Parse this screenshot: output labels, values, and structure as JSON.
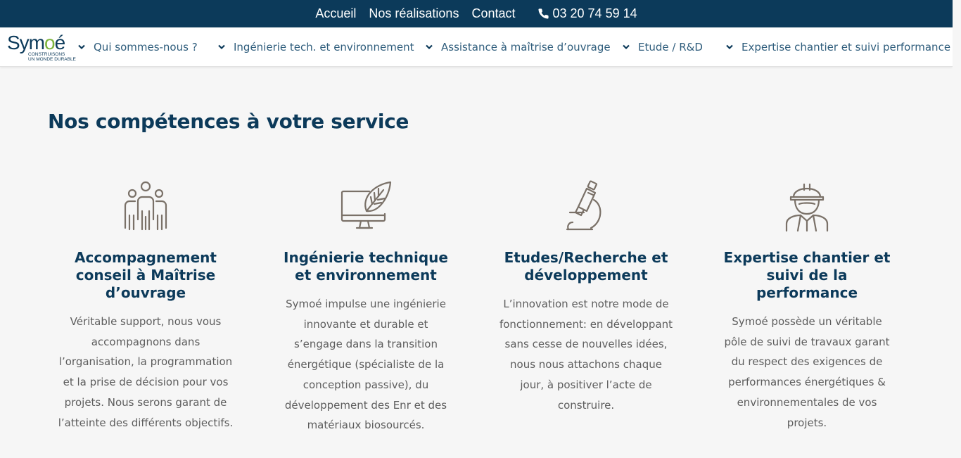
{
  "topbar": {
    "links": [
      "Accueil",
      "Nos réalisations",
      "Contact"
    ],
    "phone": "03 20 74 59 14",
    "bg_color": "#0c3a5a"
  },
  "logo": {
    "word_left": "Sym",
    "word_mid": "o",
    "word_right": "é",
    "tagline_1": "CONSTRUISONS",
    "tagline_2": "UN MONDE DURABLE"
  },
  "nav": {
    "items": [
      "Qui sommes-nous ?",
      "Ingénierie tech. et environnement",
      "Assistance à maîtrise d’ouvrage",
      "Etude / R&D",
      "Expertise chantier et suivi performance"
    ]
  },
  "main": {
    "title": "Nos compétences à votre service",
    "services": [
      {
        "icon": "team-icon",
        "title": "Accompagnement conseil à Maîtrise d’ouvrage",
        "text": "Véritable support, nous vous accompagnons dans l’organisation, la programmation et la prise de décision pour vos projets. Nous serons garant de l’atteinte des différents objectifs."
      },
      {
        "icon": "monitor-leaf-icon",
        "title": "Ingénierie technique et environnement",
        "text": "Symoé impulse une ingénierie innovante et durable et s’engage dans la transition énergétique (spécialiste de la conception passive), du développement des Enr et des matériaux biosourcés."
      },
      {
        "icon": "microscope-icon",
        "title": "Etudes/Recherche et développement",
        "text": "L’innovation est notre mode de fonctionnement: en développant sans cesse de nouvelles idées, nous nous attachons chaque jour, à positiver l’acte de construire."
      },
      {
        "icon": "worker-helmet-icon",
        "title": "Expertise chantier et suivi de la performance",
        "text": "Symoé possède un véritable pôle de suivi de travaux garant du respect des exigences de performances énergétiques & environnementales de vos projets."
      }
    ]
  },
  "colors": {
    "primary": "#0c3a5a",
    "accent_green": "#7bb33a",
    "icon_gray": "#7a7168"
  }
}
